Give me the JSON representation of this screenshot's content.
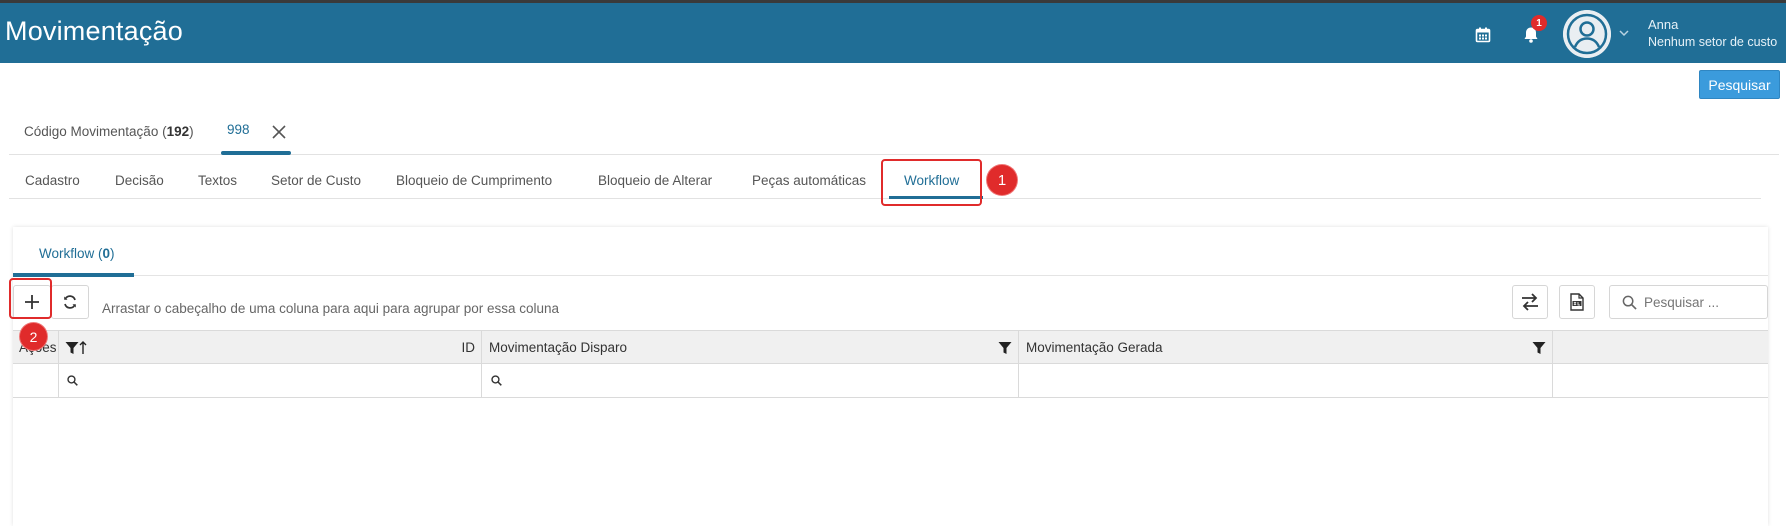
{
  "header": {
    "title": "Movimentação",
    "notifications_count": "1",
    "user_name": "Anna",
    "user_sector": "Nenhum setor de custo"
  },
  "toolbar": {
    "search_label": "Pesquisar"
  },
  "tabs_top": [
    {
      "label_prefix": "Código Movimentação (",
      "count": "192",
      "label_suffix": ")"
    },
    {
      "label": "998"
    }
  ],
  "tabs_second": [
    {
      "label": "Cadastro"
    },
    {
      "label": "Decisão"
    },
    {
      "label": "Textos"
    },
    {
      "label": "Setor de Custo"
    },
    {
      "label": "Bloqueio de Cumprimento"
    },
    {
      "label": "Bloqueio de Alterar"
    },
    {
      "label": "Peças automáticas"
    },
    {
      "label": "Workflow"
    }
  ],
  "markers": [
    "1",
    "2"
  ],
  "panel": {
    "tab_prefix": "Workflow (",
    "tab_count": "0",
    "tab_suffix": ")",
    "group_hint": "Arrastar o cabeçalho de uma coluna para aqui para agrupar por essa coluna",
    "search_placeholder": "Pesquisar ..."
  },
  "grid": {
    "columns": [
      "Ações",
      "ID",
      "Movimentação Disparo",
      "Movimentação Gerada"
    ]
  },
  "colors": {
    "header": "#206e96",
    "accent_button": "#3b9bdc",
    "highlight": "#e02b2b"
  }
}
